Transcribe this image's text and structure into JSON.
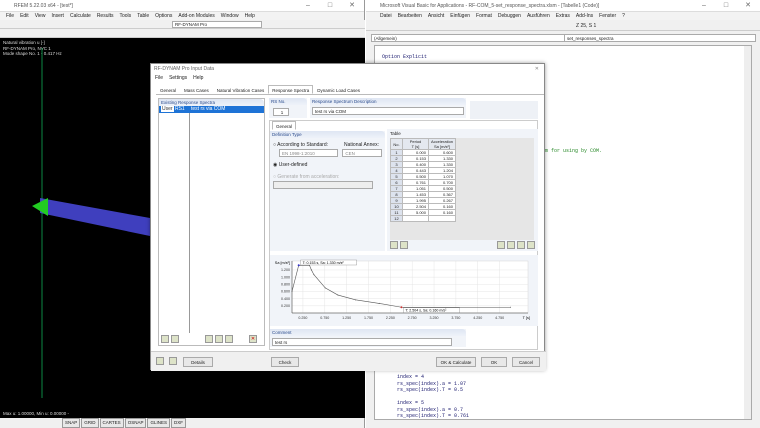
{
  "rfem": {
    "title": "RFEM 5.22.03 x64 - [test*]",
    "menu": [
      "File",
      "Edit",
      "View",
      "Insert",
      "Calculate",
      "Results",
      "Tools",
      "Table",
      "Options",
      "Add-on Modules",
      "Window",
      "Help"
    ],
    "module_select": "RF-DYNAM Pro",
    "overlay": [
      "Natural vibration u [-]",
      "RF-DYNAM Pro, NVC 1",
      "Mode shape No. 1 - 0.417 Hz"
    ],
    "minmax": "Max u: 1.00000, Min u: 0.00000 -",
    "status": [
      "SNAP",
      "GRID",
      "CARTES",
      "OSNAP",
      "GLINES",
      "DXF"
    ]
  },
  "vba": {
    "title": "Microsoft Visual Basic for Applications - RF-COM_5-set_response_spectra.xlsm - [Tabelle1 (Code)]",
    "menu": [
      "Datei",
      "Bearbeiten",
      "Ansicht",
      "Einfügen",
      "Format",
      "Debuggen",
      "Ausführen",
      "Extras",
      "Add-Ins",
      "Fenster",
      "?"
    ],
    "position": "Z 25, S 1",
    "object_select": "(Allgemein)",
    "proc_select": "set_responses_spectra",
    "code_top": "Option Explicit",
    "comment": "m for using by COM.",
    "code_bottom": [
      "index = 4",
      "rs_spec(index).a = 1.07",
      "rs_spec(index).T = 0.5",
      "",
      "index = 5",
      "rs_spec(index).a = 0.7",
      "rs_spec(index).T = 0.761"
    ]
  },
  "dialog": {
    "title": "RF-DYNAM Pro Input Data",
    "menu": [
      "File",
      "Settings",
      "Help"
    ],
    "tabs": [
      "General",
      "Mass Cases",
      "Natural Vibration Cases",
      "Response Spectra",
      "Dynamic Load Cases"
    ],
    "active_tab": "Response Spectra",
    "existing_header": "Existing Response Spectra",
    "existing_items": [
      {
        "badge": "User",
        "id": "RS1",
        "name": "test rs via COM"
      }
    ],
    "rs_no_label": "RS No.",
    "rs_no": "1",
    "desc_label": "Response Spectrum Description",
    "desc_value": "test rs via COM",
    "subtab": "General",
    "def_type_header": "Definition Type",
    "opt_standard": "According to Standard:",
    "national_annex_label": "National Annex:",
    "standard_value": "EN 1998-1:2010",
    "annex_value": "CEN",
    "opt_user": "User-defined",
    "opt_generate": "Generate from acceleration:",
    "table_tab": "Table",
    "table_headers": [
      "No.",
      "Period\nT [s]",
      "Acceleration\nSa [m/s²]"
    ],
    "comment_label": "Comment",
    "comment_value": "test rs",
    "buttons": {
      "details": "Details",
      "check": "Check",
      "ok_calc": "OK & Calculate",
      "ok": "OK",
      "cancel": "Cancel"
    }
  },
  "chart_data": {
    "type": "line",
    "x": [
      0.0,
      0.153,
      0.4,
      0.443,
      0.5,
      0.761,
      1.051,
      1.453,
      1.995,
      2.504,
      5.0
    ],
    "y": [
      0.6,
      1.33,
      1.33,
      1.204,
      1.07,
      0.7,
      0.5,
      0.367,
      0.267,
      0.16,
      0.16
    ],
    "rows": [
      1,
      2,
      3,
      4,
      5,
      6,
      7,
      8,
      9,
      10,
      11,
      12
    ],
    "xticks": [
      "0.250",
      "0.750",
      "1.250",
      "1.750",
      "2.250",
      "2.750",
      "3.250",
      "3.750",
      "4.250",
      "4.750"
    ],
    "yticks": [
      "0.200",
      "0.400",
      "0.600",
      "0.800",
      "1.000",
      "1.200"
    ],
    "xlabel": "T [s]",
    "ylabel": "Sa [m/s²]",
    "annotations": [
      "T: 0.153 s, Sa: 1.330 m/s²",
      "T: 2.504 s, Sa: 0.160 m/s²"
    ],
    "xlim": [
      0,
      5.4
    ],
    "ylim": [
      0,
      1.45
    ],
    "grid": true,
    "color": "#555555"
  }
}
